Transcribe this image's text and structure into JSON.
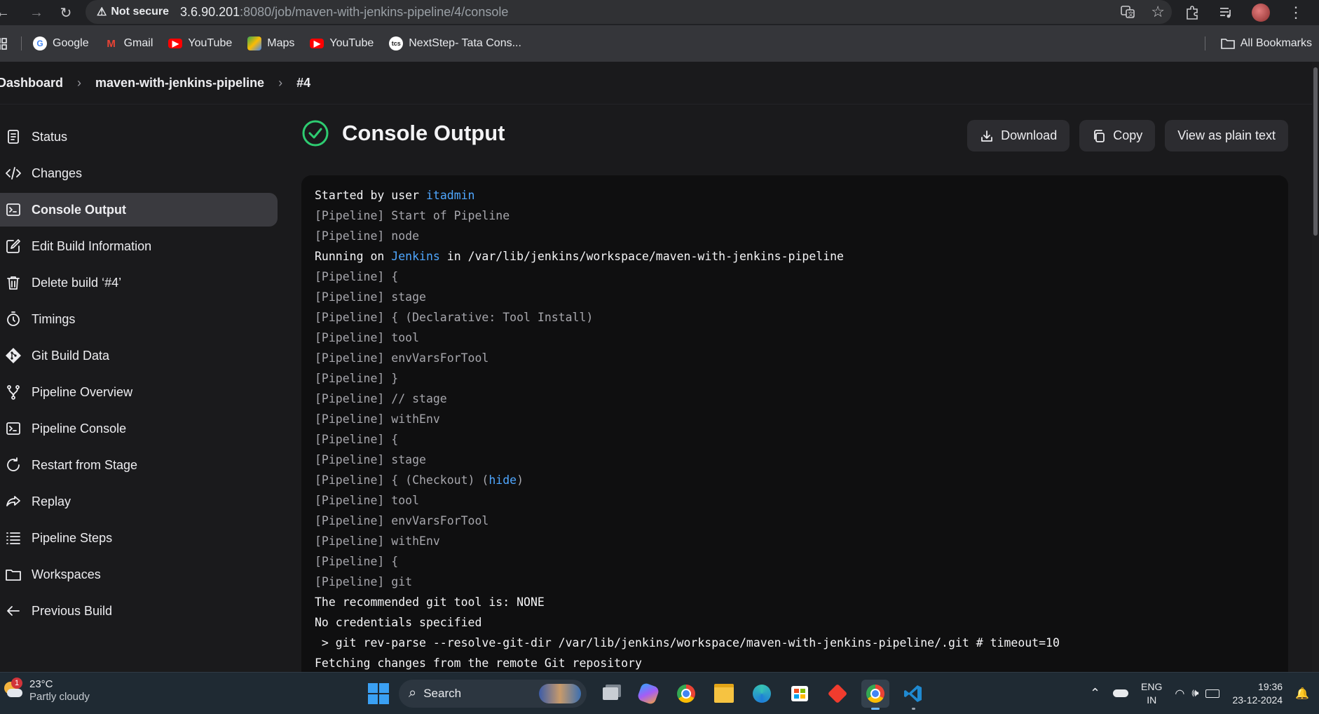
{
  "browser": {
    "security_label": "Not secure",
    "url_host": "3.6.90.201",
    "url_path": ":8080/job/maven-with-jenkins-pipeline/4/console",
    "bookmarks": [
      {
        "label": "Google",
        "icon": "google-icon"
      },
      {
        "label": "Gmail",
        "icon": "gmail-icon"
      },
      {
        "label": "YouTube",
        "icon": "youtube-icon"
      },
      {
        "label": "Maps",
        "icon": "maps-icon"
      },
      {
        "label": "YouTube",
        "icon": "youtube-icon"
      },
      {
        "label": "NextStep- Tata Cons...",
        "icon": "tcs-icon"
      }
    ],
    "all_bookmarks_label": "All Bookmarks"
  },
  "breadcrumb": {
    "items": [
      "Dashboard",
      "maven-with-jenkins-pipeline",
      "#4"
    ]
  },
  "sidebar": {
    "items": [
      {
        "label": "Status",
        "icon": "document-icon"
      },
      {
        "label": "Changes",
        "icon": "code-icon"
      },
      {
        "label": "Console Output",
        "icon": "terminal-icon",
        "active": true
      },
      {
        "label": "Edit Build Information",
        "icon": "edit-icon"
      },
      {
        "label": "Delete build ‘#4’",
        "icon": "trash-icon"
      },
      {
        "label": "Timings",
        "icon": "stopwatch-icon"
      },
      {
        "label": "Git Build Data",
        "icon": "git-icon"
      },
      {
        "label": "Pipeline Overview",
        "icon": "branch-icon"
      },
      {
        "label": "Pipeline Console",
        "icon": "terminal-icon"
      },
      {
        "label": "Restart from Stage",
        "icon": "restart-icon"
      },
      {
        "label": "Replay",
        "icon": "replay-icon"
      },
      {
        "label": "Pipeline Steps",
        "icon": "list-icon"
      },
      {
        "label": "Workspaces",
        "icon": "folder-icon"
      },
      {
        "label": "Previous Build",
        "icon": "arrow-left-icon"
      }
    ]
  },
  "main": {
    "title": "Console Output",
    "status_color": "#2ecc71",
    "actions": {
      "download": "Download",
      "copy": "Copy",
      "plain_text": "View as plain text"
    }
  },
  "console": {
    "line0": {
      "prefix": "Started by user ",
      "link": "itadmin"
    },
    "line1": "[Pipeline] Start of Pipeline",
    "line2": "[Pipeline] node",
    "line3": {
      "prefix": "Running on ",
      "link": "Jenkins",
      "suffix": " in /var/lib/jenkins/workspace/maven-with-jenkins-pipeline"
    },
    "line4": "[Pipeline] {",
    "line5": "[Pipeline] stage",
    "line6": "[Pipeline] { (Declarative: Tool Install)",
    "line7": "[Pipeline] tool",
    "line8": "[Pipeline] envVarsForTool",
    "line9": "[Pipeline] }",
    "line10": "[Pipeline] // stage",
    "line11": "[Pipeline] withEnv",
    "line12": "[Pipeline] {",
    "line13": "[Pipeline] stage",
    "line14": {
      "prefix": "[Pipeline] { (Checkout) (",
      "link": "hide",
      "suffix": ")"
    },
    "line15": "[Pipeline] tool",
    "line16": "[Pipeline] envVarsForTool",
    "line17": "[Pipeline] withEnv",
    "line18": "[Pipeline] {",
    "line19": "[Pipeline] git",
    "line20": "The recommended git tool is: NONE",
    "line21": "No credentials specified",
    "line22": " > git rev-parse --resolve-git-dir /var/lib/jenkins/workspace/maven-with-jenkins-pipeline/.git # timeout=10",
    "line23": "Fetching changes from the remote Git repository"
  },
  "taskbar": {
    "weather_temp": "23°C",
    "weather_desc": "Partly cloudy",
    "weather_badge": "1",
    "search_label": "Search",
    "lang_top": "ENG",
    "lang_bottom": "IN",
    "time": "19:36",
    "date": "23-12-2024"
  }
}
